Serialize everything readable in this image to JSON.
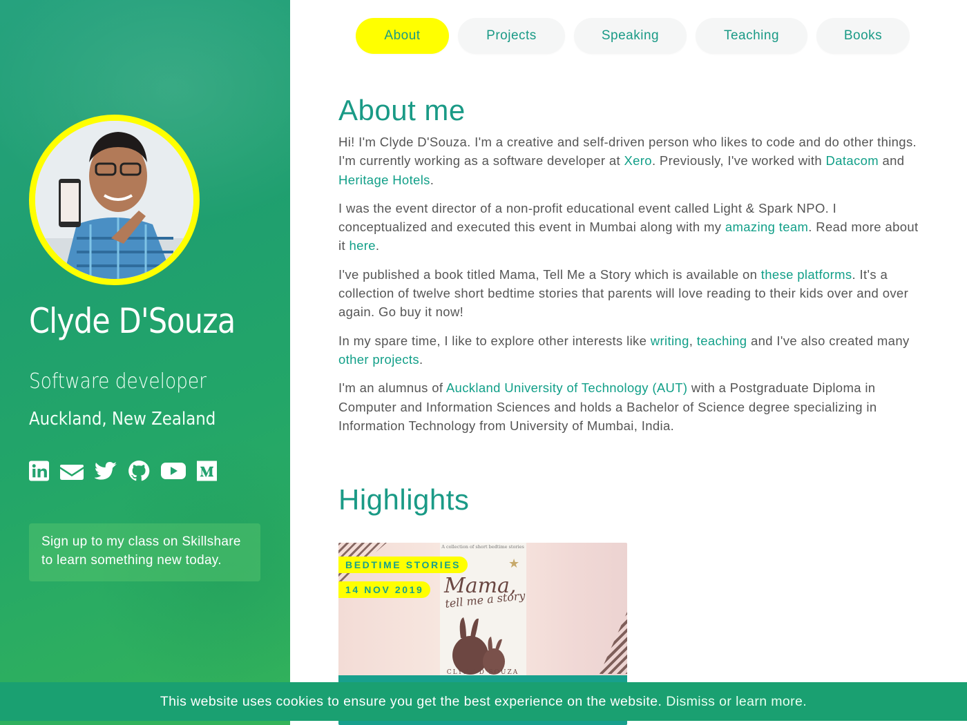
{
  "colors": {
    "accent": "#1a9a86",
    "highlight": "#ffff00",
    "sidebar": "#23a26f"
  },
  "profile": {
    "name": "Clyde D'Souza",
    "role": "Software developer",
    "location": "Auckland, New Zealand",
    "social_icons": [
      "linkedin-icon",
      "email-icon",
      "twitter-icon",
      "github-icon",
      "youtube-icon",
      "medium-icon"
    ],
    "promo": "Sign up to my class on Skillshare to learn something new today."
  },
  "nav": {
    "items": [
      {
        "label": "About",
        "active": true
      },
      {
        "label": "Projects",
        "active": false
      },
      {
        "label": "Speaking",
        "active": false
      },
      {
        "label": "Teaching",
        "active": false
      },
      {
        "label": "Books",
        "active": false
      }
    ]
  },
  "about": {
    "title": "About me",
    "p1": {
      "a": "Hi! I'm Clyde D'Souza. I'm a creative and self-driven person who likes to code and do other things. I'm currently working as a software developer at ",
      "link1": "Xero",
      "b": ". Previously, I've worked with ",
      "link2": "Datacom",
      "c": " and ",
      "link3": "Heritage Hotels",
      "d": "."
    },
    "p2": {
      "a": "I was the event director of a non-profit educational event called Light & Spark NPO. I conceptualized and executed this event in Mumbai along with my ",
      "link1": "amazing team",
      "b": ". Read more about it ",
      "link2": "here",
      "c": "."
    },
    "p3": {
      "a": "I've published a book titled Mama, Tell Me a Story which is available on ",
      "link1": "these platforms",
      "b": ". It's a collection of twelve short bedtime stories that parents will love reading to their kids over and over again. Go buy it now!"
    },
    "p4": {
      "a": "In my spare time, I like to explore other interests like ",
      "link1": "writing",
      "b": ", ",
      "link2": "teaching",
      "c": " and I've also created many ",
      "link3": "other projects",
      "d": "."
    },
    "p5": {
      "a": "I'm an alumnus of ",
      "link1": "Auckland University of Technology (AUT)",
      "b": " with a Postgraduate Diploma in Computer and Information Sciences and holds a Bachelor of Science degree specializing in Information Technology from University of Mumbai, India."
    }
  },
  "highlights": {
    "title": "Highlights",
    "card": {
      "tag1": "BEDTIME STORIES",
      "tag2": "14 NOV 2019",
      "book_caption": "A collection of short bedtime stories",
      "book_title_1": "Mama,",
      "book_title_2": "tell me a story",
      "book_author": "CLYDE D'SOUZA"
    }
  },
  "cookie": {
    "text": "This website uses cookies to ensure you get the best experience on the website.",
    "link": "Dismiss or learn more."
  }
}
